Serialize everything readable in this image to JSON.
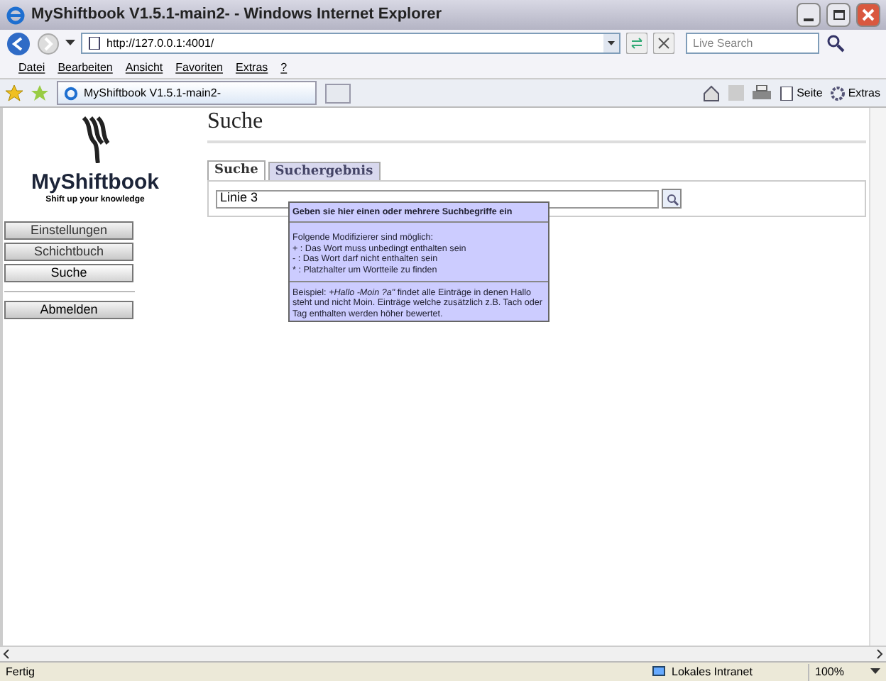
{
  "window": {
    "title": "MyShiftbook V1.5.1-main2- - Windows Internet Explorer"
  },
  "address_bar": {
    "url": "http://127.0.0.1:4001/",
    "search_placeholder": "Live Search"
  },
  "menu": [
    "Datei",
    "Bearbeiten",
    "Ansicht",
    "Favoriten",
    "Extras",
    "?"
  ],
  "browser_tab": {
    "title": "MyShiftbook V1.5.1-main2-"
  },
  "command_bar": [
    "Seite",
    "Extras"
  ],
  "logo": {
    "name": "MyShiftbook",
    "tagline": "Shift up your knowledge"
  },
  "nav_buttons": [
    {
      "label": "Einstellungen",
      "selected": false
    },
    {
      "label": "Schichtbuch",
      "selected": false
    },
    {
      "label": "Suche",
      "selected": true
    }
  ],
  "logout_button": "Abmelden",
  "page_title": "Suche",
  "tabs": [
    {
      "label": "Suche",
      "selected": true
    },
    {
      "label": "Suchergebnis",
      "selected": false
    }
  ],
  "search": {
    "value": "Linie 3"
  },
  "tooltip": {
    "title": "Geben sie hier einen oder mehrere Suchbegriffe ein",
    "lines": [
      "Folgende Modifizierer sind möglich:",
      "+ : Das Wort muss unbedingt enthalten sein",
      "- : Das Wort darf nicht enthalten sein",
      "* : Platzhalter um Wortteile zu finden"
    ],
    "example": "Beispiel: *+Hallo -Moin ?a\"* findet alle Einträge in denen Hallo steht und nicht Moin. Einträge welche zusätzlich z.B. Tach oder Tag enthalten werden höher bewertet."
  },
  "status_bar": {
    "text": "Fertig",
    "zone": "Lokales Intranet",
    "zoom": "100%"
  }
}
